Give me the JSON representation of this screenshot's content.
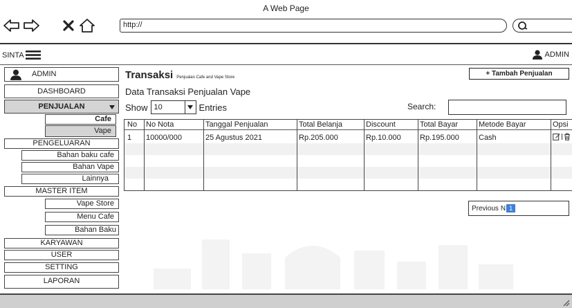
{
  "browser": {
    "title": "A Web Page",
    "url": "http://"
  },
  "app": {
    "brand": "SINTA",
    "user": "ADMIN"
  },
  "sidebar": {
    "profile": "ADMIN",
    "dashboard": "DASHBOARD",
    "penjualan": "PENJUALAN",
    "penjualan_sub": [
      "Cafe",
      "Vape"
    ],
    "pengeluaran": "PENGELUARAN",
    "pengeluaran_sub": [
      "Bahan baku cafe",
      "Bahan Vape",
      "Lainnya"
    ],
    "master_item": "MASTER ITEM",
    "master_sub": [
      "Vape Store",
      "Menu Cafe",
      "Bahan Baku"
    ],
    "karyawan": "KARYAWAN",
    "user": "USER",
    "setting": "SETTING",
    "laporan": "LAPORAN"
  },
  "main": {
    "title": "Transaksi",
    "subtitle": "Penjualan Cafe and Vape Store",
    "add_button": "+ Tambah Penjualan",
    "section_title": "Data Transaksi Penjualan Vape",
    "show_label": "Show",
    "entries_value": "10",
    "entries_label": "Entries",
    "search_label": "Search:",
    "search_value": ""
  },
  "table": {
    "columns": [
      "No",
      "No Nota",
      "Tanggal Penjualan",
      "Total Belanja",
      "Discount",
      "Total Bayar",
      "Metode Bayar",
      "Opsi"
    ],
    "rows": [
      [
        "1",
        "10000/000",
        "25 Agustus 2021",
        "Rp.205.000",
        "Rp.10.000",
        "Rp.195.000",
        "Cash",
        ""
      ]
    ]
  },
  "pagination": {
    "previous": "Previous",
    "next_partial": "N",
    "current": "1"
  },
  "colors": {
    "active_nav": "#d4d4d4",
    "page_highlight": "#3f7fd8",
    "row_stripe": "#f1f1f1"
  }
}
